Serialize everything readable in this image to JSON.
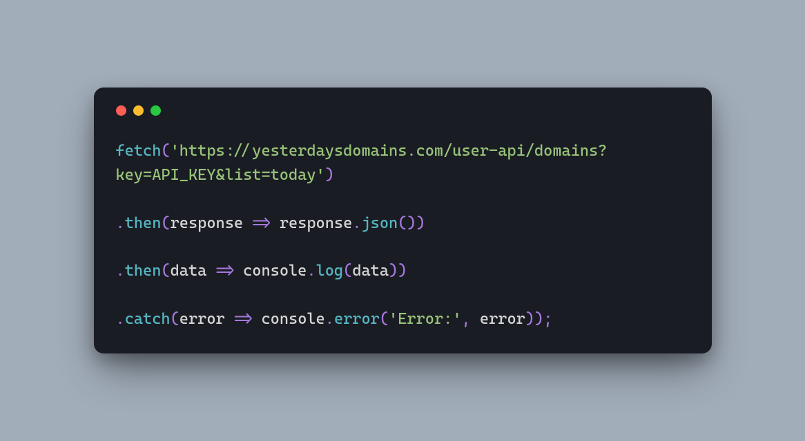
{
  "window": {
    "traffic_lights": {
      "close": "red",
      "minimize": "yellow",
      "zoom": "green"
    }
  },
  "code": {
    "line1_fn": "fetch",
    "line1_open": "(",
    "line1_str": "'https://yesterdaysdomains.com/user-api/domains?key=API_KEY&list=today'",
    "line1_close": ")",
    "line2_dot": ".",
    "line2_method": "then",
    "line2_open": "(",
    "line2_param": "response",
    "line2_arrow": " => ",
    "line2_obj": "response",
    "line2_pdot": ".",
    "line2_prop": "json",
    "line2_call": "()",
    "line2_close": ")",
    "line3_dot": ".",
    "line3_method": "then",
    "line3_open": "(",
    "line3_param": "data",
    "line3_arrow": " => ",
    "line3_obj": "console",
    "line3_pdot": ".",
    "line3_prop": "log",
    "line3_callopen": "(",
    "line3_arg": "data",
    "line3_callclose": ")",
    "line3_close": ")",
    "line4_dot": ".",
    "line4_method": "catch",
    "line4_open": "(",
    "line4_param": "error",
    "line4_arrow": " => ",
    "line4_obj": "console",
    "line4_pdot": ".",
    "line4_prop": "error",
    "line4_callopen": "(",
    "line4_str": "'Error:'",
    "line4_comma": ", ",
    "line4_arg": "error",
    "line4_callclose": ")",
    "line4_close": ")",
    "line4_semi": ";"
  }
}
